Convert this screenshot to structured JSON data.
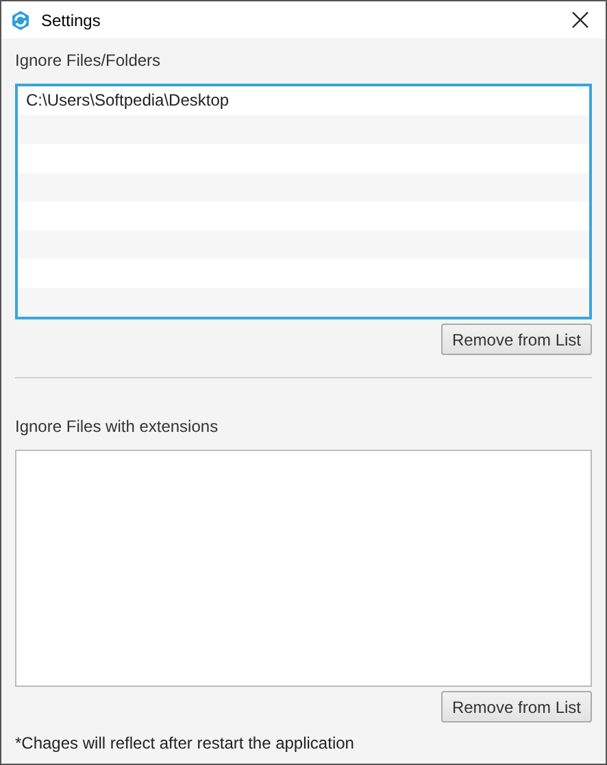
{
  "window": {
    "title": "Settings"
  },
  "folders": {
    "label": "Ignore Files/Folders",
    "items": [
      "C:\\Users\\Softpedia\\Desktop"
    ],
    "button": "Remove from List"
  },
  "extensions": {
    "label": "Ignore Files with extensions",
    "button": "Remove from List"
  },
  "note": "*Chages will reflect after restart the application"
}
